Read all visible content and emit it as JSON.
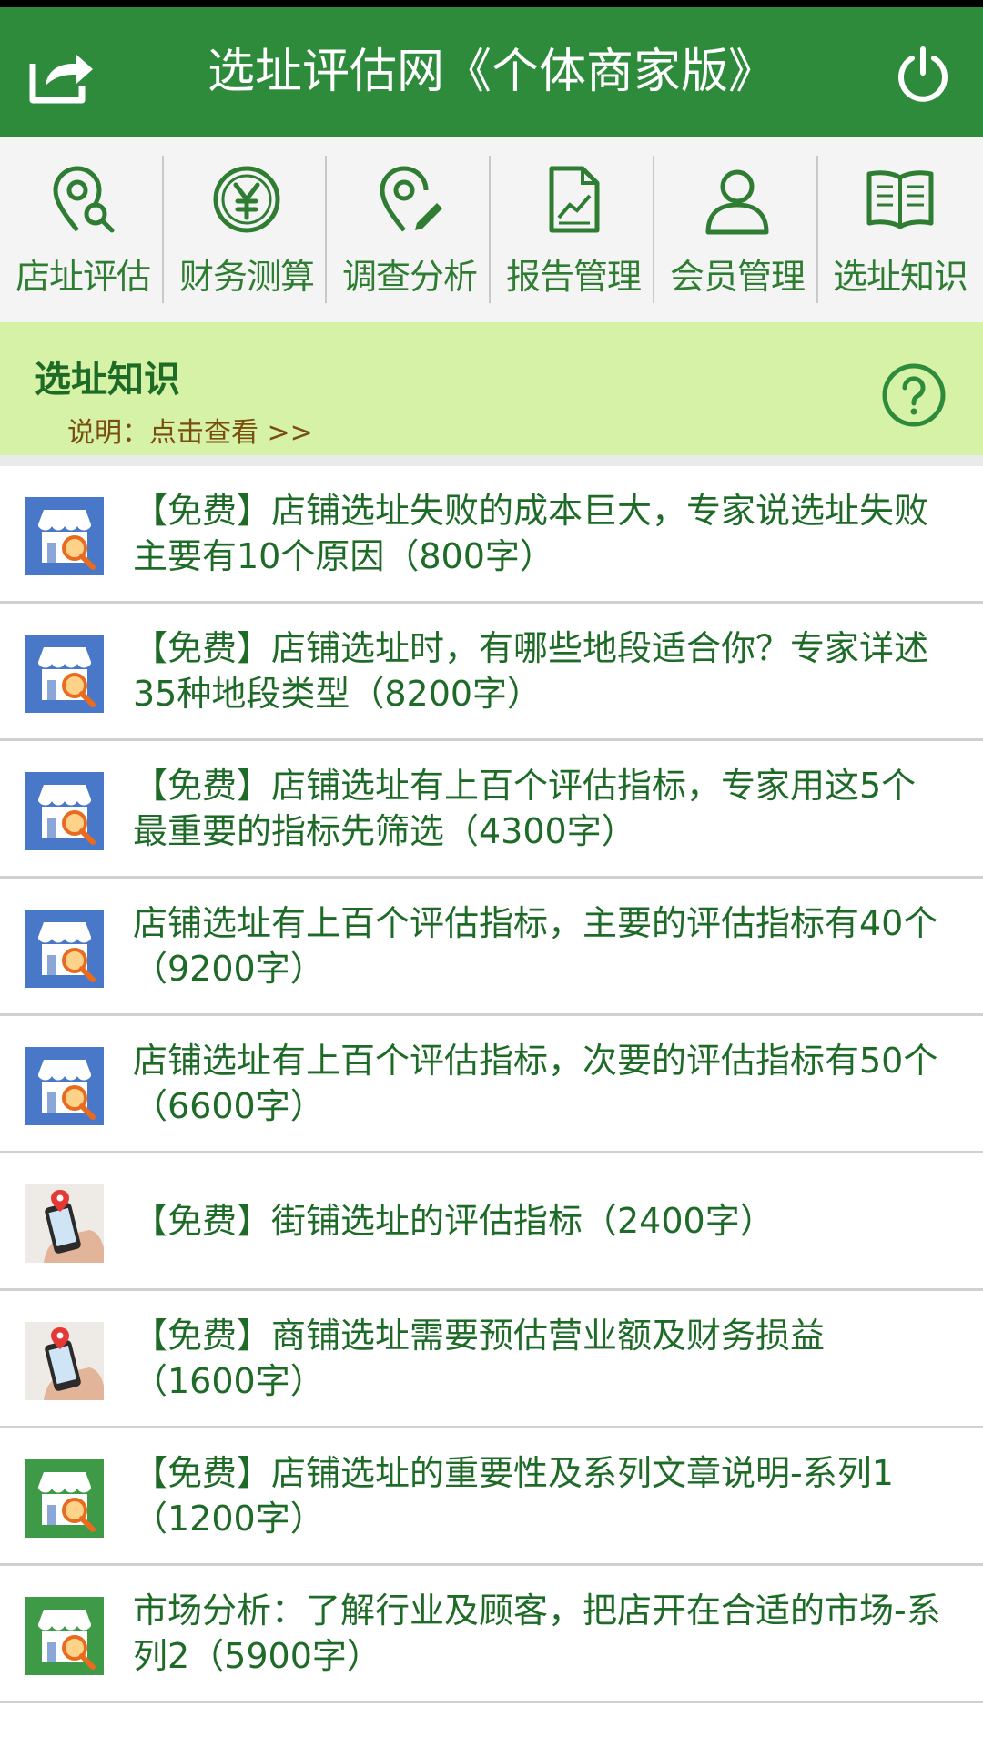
{
  "header": {
    "title": "选址评估网《个体商家版》",
    "share_icon": "share-icon",
    "power_icon": "power-icon"
  },
  "toolbar": {
    "items": [
      {
        "label": "店址评估",
        "icon": "location-search-icon"
      },
      {
        "label": "财务测算",
        "icon": "yuan-coin-icon"
      },
      {
        "label": "调查分析",
        "icon": "location-edit-icon"
      },
      {
        "label": "报告管理",
        "icon": "report-chart-icon"
      },
      {
        "label": "会员管理",
        "icon": "user-icon"
      },
      {
        "label": "选址知识",
        "icon": "book-icon"
      }
    ]
  },
  "section": {
    "title": "选址知识",
    "description": "说明：点击查看 >>",
    "help_icon": "question-circle-icon"
  },
  "articles": [
    {
      "text": "【免费】店铺选址失败的成本巨大，专家说选址失败主要有10个原因（800字）",
      "thumb": "store-search-blue"
    },
    {
      "text": "【免费】店铺选址时，有哪些地段适合你？专家详述35种地段类型（8200字）",
      "thumb": "store-search-blue"
    },
    {
      "text": "【免费】店铺选址有上百个评估指标，专家用这5个最重要的指标先筛选（4300字）",
      "thumb": "store-search-blue"
    },
    {
      "text": "店铺选址有上百个评估指标，主要的评估指标有40个（9200字）",
      "thumb": "store-search-blue"
    },
    {
      "text": "店铺选址有上百个评估指标，次要的评估指标有50个（6600字）",
      "thumb": "store-search-blue"
    },
    {
      "text": "【免费】街铺选址的评估指标（2400字）",
      "thumb": "phone-map-photo"
    },
    {
      "text": "【免费】商铺选址需要预估营业额及财务损益（1600字）",
      "thumb": "phone-map-photo"
    },
    {
      "text": "【免费】店铺选址的重要性及系列文章说明-系列1（1200字）",
      "thumb": "store-search-green"
    },
    {
      "text": "市场分析：了解行业及顾客，把店开在合适的市场-系列2（5900字）",
      "thumb": "store-search-green"
    }
  ],
  "colors": {
    "header_bg": "#2e8b3c",
    "accent_green": "#1e6b27",
    "section_bg": "#d6f2a6",
    "thumb_blue": "#4a78c8",
    "thumb_green": "#3f9a48"
  }
}
